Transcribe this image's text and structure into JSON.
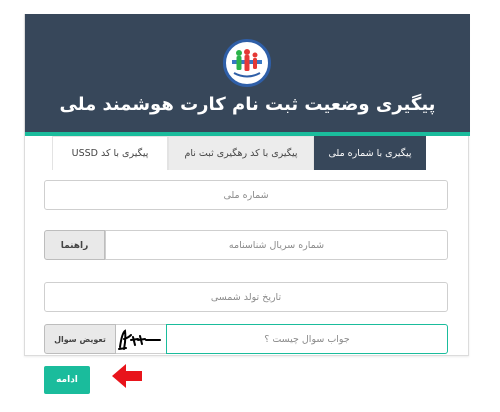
{
  "header": {
    "title": "پیگیری وضعیت ثبت نام کارت هوشمند ملی",
    "logo_icon": "national-registry-logo-icon",
    "bg_color": "#37475a",
    "accent_color": "#1abc9c"
  },
  "tabs": [
    {
      "label": "پیگیری با شماره ملی",
      "active": true
    },
    {
      "label": "پیگیری با کد رهگیری ثبت نام",
      "active": false
    },
    {
      "label": "پیگیری با کد USSD",
      "active": false
    }
  ],
  "form": {
    "national_code_placeholder": "شماره ملی",
    "serial_placeholder": "شماره سریال شناسنامه",
    "guide_label": "راهنما",
    "birthdate_placeholder": "تاریخ تولد شمسی",
    "answer_placeholder": "جواب سوال چیست ؟",
    "change_question_label": "تعویض سوال",
    "submit_label": "ادامه"
  },
  "annotation": {
    "arrow_icon": "red-arrow-icon",
    "arrow_color": "#e8141b"
  }
}
